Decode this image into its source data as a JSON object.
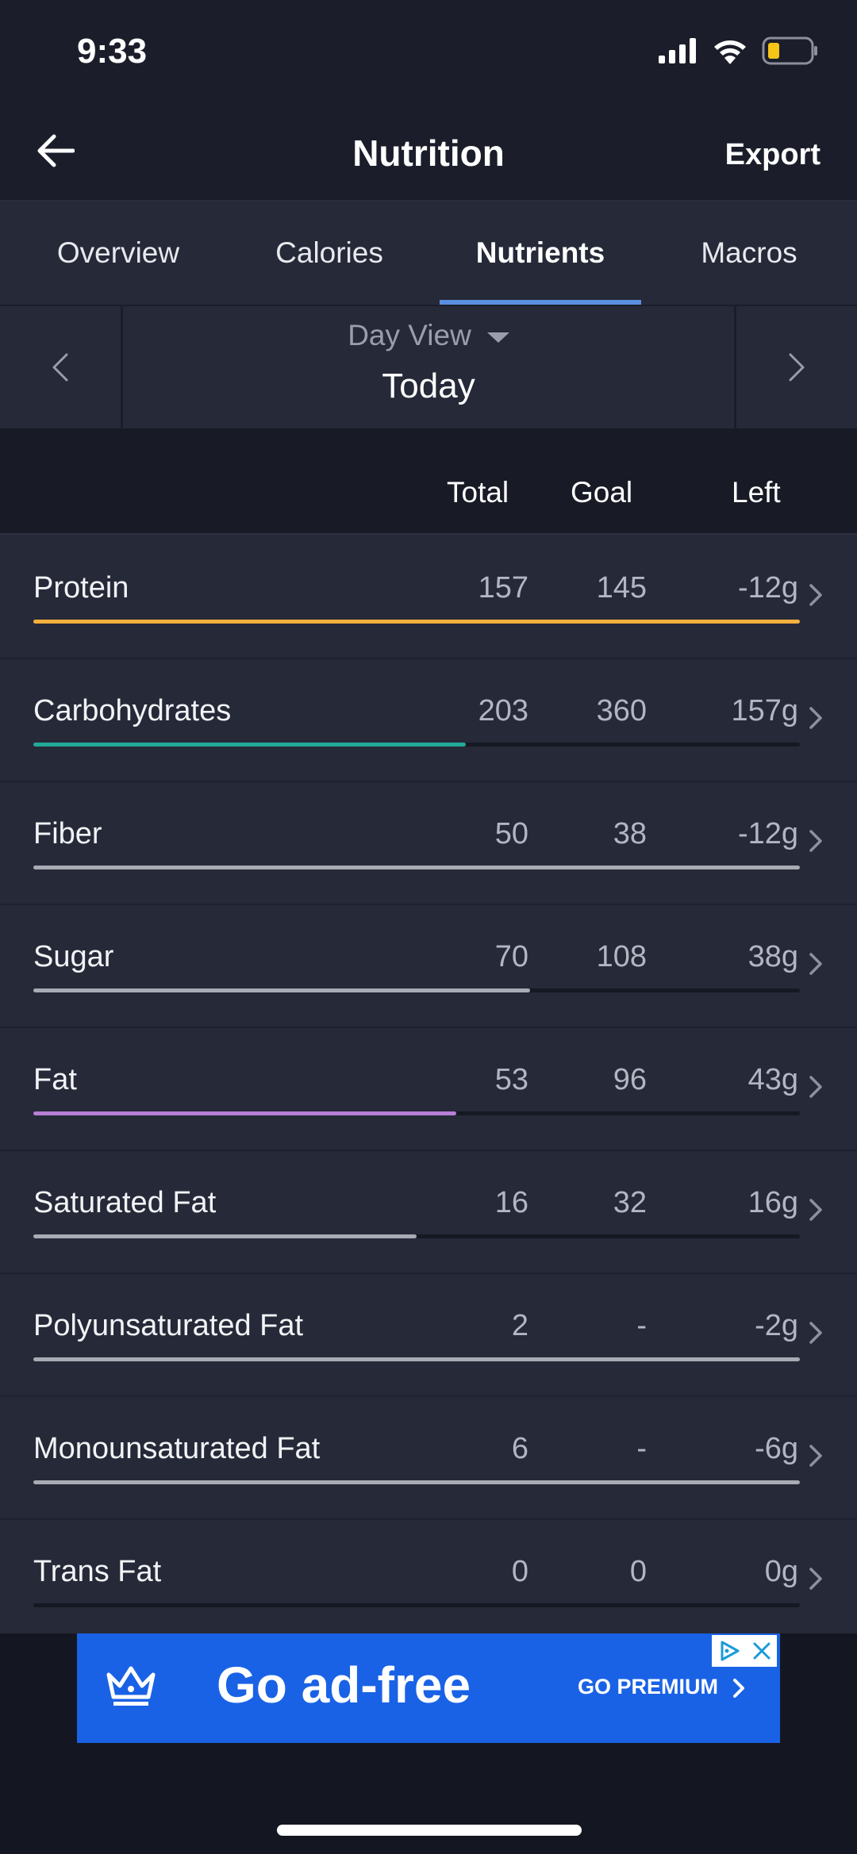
{
  "status_bar": {
    "time": "9:33"
  },
  "header": {
    "title": "Nutrition",
    "export_label": "Export"
  },
  "tabs": [
    {
      "label": "Overview"
    },
    {
      "label": "Calories"
    },
    {
      "label": "Nutrients",
      "active": true
    },
    {
      "label": "Macros"
    }
  ],
  "date_nav": {
    "mode": "Day View",
    "value": "Today"
  },
  "columns": {
    "total": "Total",
    "goal": "Goal",
    "left": "Left"
  },
  "nutrients": [
    {
      "name": "Protein",
      "total": "157",
      "goal": "145",
      "left": "-12g",
      "progress": 1.0,
      "color": "#f5b13d"
    },
    {
      "name": "Carbohydrates",
      "total": "203",
      "goal": "360",
      "left": "157g",
      "progress": 0.564,
      "color": "#22a99a"
    },
    {
      "name": "Fiber",
      "total": "50",
      "goal": "38",
      "left": "-12g",
      "progress": 1.0,
      "color": "#a9abb4"
    },
    {
      "name": "Sugar",
      "total": "70",
      "goal": "108",
      "left": "38g",
      "progress": 0.648,
      "color": "#a9abb4"
    },
    {
      "name": "Fat",
      "total": "53",
      "goal": "96",
      "left": "43g",
      "progress": 0.552,
      "color": "#b77fd6"
    },
    {
      "name": "Saturated Fat",
      "total": "16",
      "goal": "32",
      "left": "16g",
      "progress": 0.5,
      "color": "#a9abb4"
    },
    {
      "name": "Polyunsaturated Fat",
      "total": "2",
      "goal": "-",
      "left": "-2g",
      "progress": 1.0,
      "color": "#a9abb4"
    },
    {
      "name": "Monounsaturated Fat",
      "total": "6",
      "goal": "-",
      "left": "-6g",
      "progress": 1.0,
      "color": "#a9abb4"
    },
    {
      "name": "Trans Fat",
      "total": "0",
      "goal": "0",
      "left": "0g",
      "progress": 0.0,
      "color": "#a9abb4"
    }
  ],
  "ad": {
    "headline": "Go ad-free",
    "cta": "GO PREMIUM",
    "color": "#1a62e5"
  }
}
